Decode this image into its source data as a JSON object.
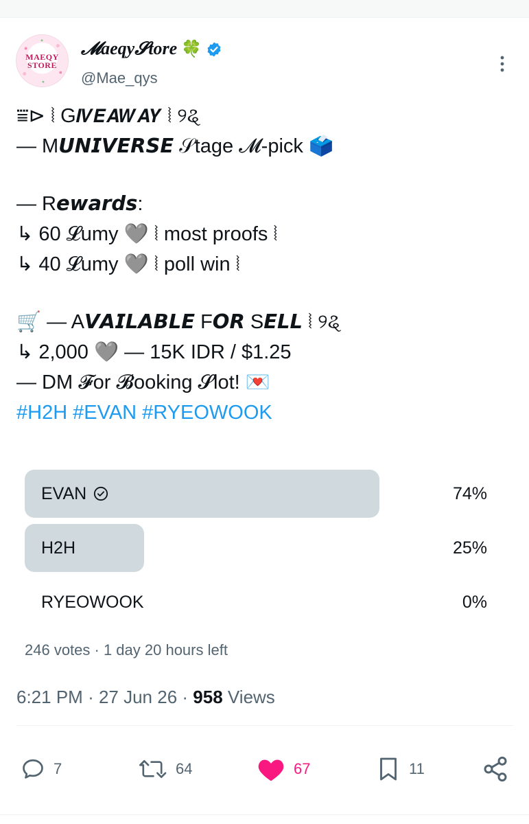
{
  "author": {
    "display_name": "𝓜aeqy𝓢tore",
    "clover": "🍀",
    "handle": "@Mae_qys",
    "avatar_text_line1": "MAEQY",
    "avatar_text_line2": "STORE",
    "verified": true
  },
  "tweet": {
    "lines": [
      "⩸⊳ ⦚ G𝙄𝙑𝙀𝘼𝙒𝘼𝙔 ⦚ ୨ୡ",
      "— M𝙐𝙉𝙄𝙑𝙀𝙍𝙎𝙀 𝒮tage 𝓜-pick 🗳️",
      "",
      "— R𝙚𝙬𝙖𝙧𝙙𝙨:",
      "↳ 60 𝓛umy 🩶 ⦚ most proofs ⦚",
      "↳ 40 𝓛umy 🩶 ⦚ poll win ⦚",
      "",
      "🛒 — A𝙑𝘼𝙄𝙇𝘼𝘽𝙇𝙀 F𝙊𝙍 S𝙀𝙇𝙇 ⦚ ୨ୡ",
      "↳ 2,000 🩶 — 15K IDR / $1.25",
      "—  DM 𝓕or 𝓑ooking 𝓢lot! 💌"
    ],
    "hashtags": [
      "#H2H",
      "#EVAN",
      "#RYEOWOOK"
    ]
  },
  "poll": {
    "options": [
      {
        "label": "EVAN",
        "percent_text": "74%",
        "fraction": 0.74,
        "chosen": true
      },
      {
        "label": "H2H",
        "percent_text": "25%",
        "fraction": 0.25,
        "chosen": false
      },
      {
        "label": "RYEOWOOK",
        "percent_text": "0%",
        "fraction": 0.0,
        "chosen": false
      }
    ],
    "summary": "246 votes · 1 day 20 hours left"
  },
  "meta": {
    "time": "6:21 PM",
    "date": "27 Jun 26",
    "views_count": "958",
    "views_label": "Views"
  },
  "actions": {
    "replies": "7",
    "reposts": "64",
    "likes": "67",
    "bookmarks": "11"
  },
  "colors": {
    "accent": "#1d9bf0",
    "like": "#f91880",
    "poll_fill": "#cfd9de",
    "secondary_text": "#536471"
  }
}
